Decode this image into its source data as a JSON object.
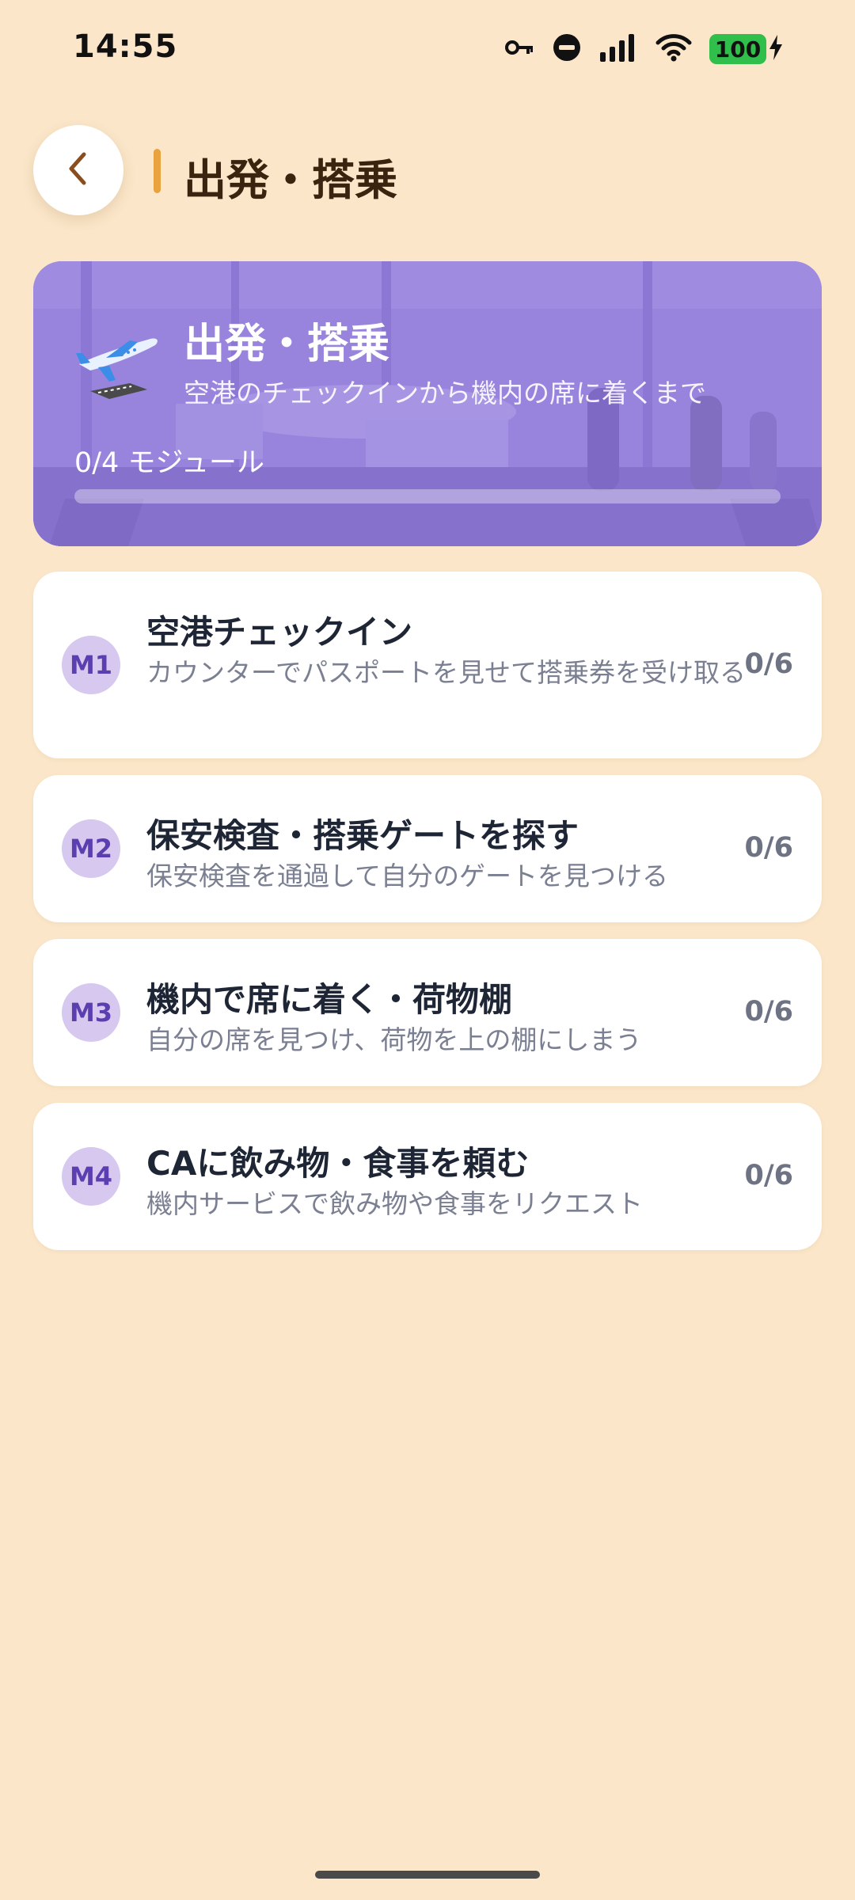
{
  "status_bar": {
    "time": "14:55",
    "battery_level": "100",
    "icons": [
      "key-icon",
      "do-not-disturb-icon",
      "signal-icon",
      "wifi-icon",
      "battery-icon",
      "charging-icon"
    ]
  },
  "header": {
    "back_icon": "chevron-left-icon",
    "title": "出発・搭乗"
  },
  "hero": {
    "icon": "airplane-icon",
    "title": "出発・搭乗",
    "subtitle": "空港のチェックインから機内の席に着くまで",
    "progress_label": "0/4 モジュール",
    "progress_fraction": 0
  },
  "modules": [
    {
      "badge": "M1",
      "title": "空港チェックイン",
      "description": "カウンターでパスポートを見せて搭乗券を受け取る",
      "progress": "0/6"
    },
    {
      "badge": "M2",
      "title": "保安検査・搭乗ゲートを探す",
      "description": "保安検査を通過して自分のゲートを見つける",
      "progress": "0/6"
    },
    {
      "badge": "M3",
      "title": "機内で席に着く・荷物棚",
      "description": "自分の席を見つけ、荷物を上の棚にしまう",
      "progress": "0/6"
    },
    {
      "badge": "M4",
      "title": "CAに飲み物・食事を頼む",
      "description": "機内サービスで飲み物や食事をリクエスト",
      "progress": "0/6"
    }
  ],
  "colors": {
    "background": "#FBE6C9",
    "hero": "#9B86DB",
    "accent": "#E8A23E",
    "badge": "#D6C8EE",
    "badge_text": "#5B3FB0"
  }
}
